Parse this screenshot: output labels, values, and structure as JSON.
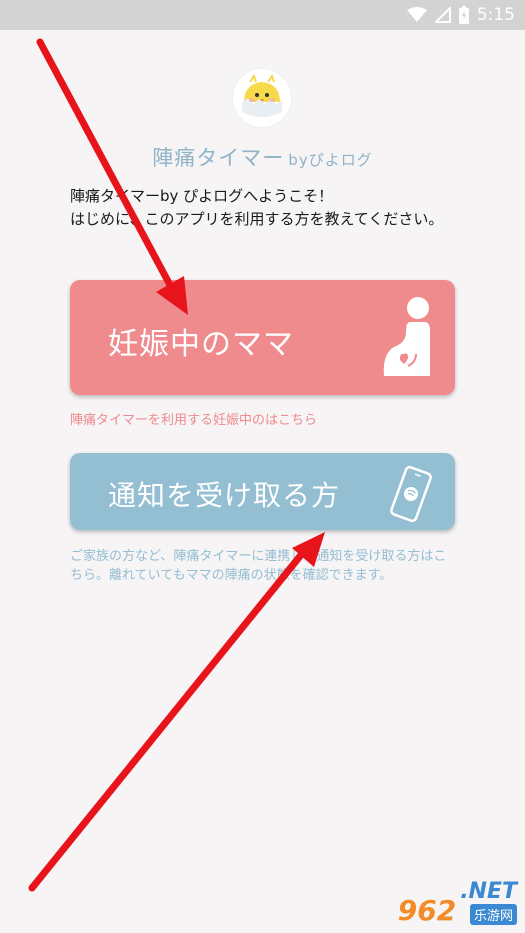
{
  "status_bar": {
    "time": "5:15"
  },
  "app": {
    "title": "陣痛タイマー",
    "title_sub": "byぴよログ"
  },
  "welcome": {
    "line1": "陣痛タイマーby ぴよログへようこそ！",
    "line2": "はじめに、このアプリを利用する方を教えてください。"
  },
  "cards": {
    "pregnant": {
      "label": "妊娠中のママ",
      "description": "陣痛タイマーを利用する妊娠中のはこちら"
    },
    "notify": {
      "label": "通知を受け取る方",
      "description": "ご家族の方など、陣痛タイマーに連携した通知を受け取る方はこちら。離れていてもママの陣痛の状態を確認できます。"
    }
  },
  "watermark": {
    "num": "962",
    "net": ".NET",
    "cn": "乐游网"
  },
  "colors": {
    "pregnant": "#ef8a8d",
    "notify": "#94bed2",
    "title": "#8fb3c7",
    "arrow": "#e8141b"
  }
}
